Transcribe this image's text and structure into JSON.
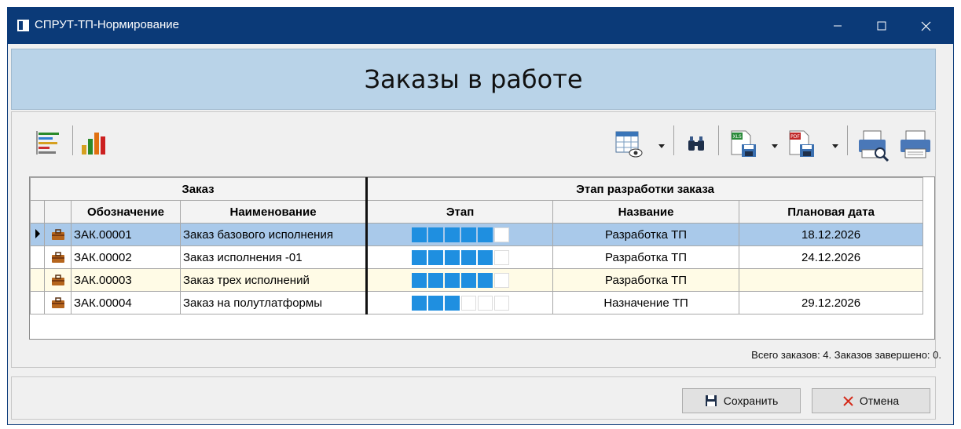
{
  "window": {
    "title": "СПРУТ-ТП-Нормирование",
    "controls": {
      "minimize": "—",
      "maximize": "☐",
      "close": "✕"
    }
  },
  "header": {
    "title": "Заказы в работе"
  },
  "toolbar": {
    "left": [
      {
        "icon": "gantt-icon"
      },
      {
        "icon": "bar-chart-icon"
      }
    ],
    "right": [
      {
        "icon": "column-view-icon",
        "dropdown": true
      },
      {
        "icon": "binoculars-icon"
      },
      {
        "icon": "export-xls-icon",
        "badge": "XLS",
        "dropdown": true
      },
      {
        "icon": "export-pdf-icon",
        "badge": "PDF",
        "dropdown": true
      },
      {
        "icon": "print-preview-icon"
      },
      {
        "icon": "printer-icon"
      }
    ]
  },
  "table": {
    "groups": {
      "order": "Заказ",
      "stage": "Этап разработки заказа"
    },
    "columns": {
      "designation": "Обозначение",
      "name": "Наименование",
      "stage": "Этап",
      "stage_name": "Название",
      "planned_date": "Плановая дата"
    },
    "rows": [
      {
        "designation": "ЗАК.00001",
        "name": "Заказ базового исполнения",
        "stage_done": 5,
        "stage_total": 6,
        "stage_name": "Разработка ТП",
        "planned_date": "18.12.2026"
      },
      {
        "designation": "ЗАК.00002",
        "name": "Заказ исполнения -01",
        "stage_done": 5,
        "stage_total": 6,
        "stage_name": "Разработка ТП",
        "planned_date": "24.12.2026"
      },
      {
        "designation": "ЗАК.00003",
        "name": "Заказ трех исполнений",
        "stage_done": 5,
        "stage_total": 6,
        "stage_name": "Разработка ТП",
        "planned_date": ""
      },
      {
        "designation": "ЗАК.00004",
        "name": "Заказ на полутлатформы",
        "stage_done": 3,
        "stage_total": 6,
        "stage_name": "Назначение ТП",
        "planned_date": "29.12.2026"
      }
    ],
    "selected_row": 0
  },
  "status": {
    "text": "Всего заказов: 4. Заказов завершено: 0."
  },
  "buttons": {
    "save": "Сохранить",
    "cancel": "Отмена"
  },
  "colors": {
    "titlebar": "#0b3a78",
    "header_band": "#b9d3e8",
    "selected_row": "#a9c9ea",
    "highlight_row": "#fffbe6",
    "progress_fill": "#1f8fe0"
  }
}
